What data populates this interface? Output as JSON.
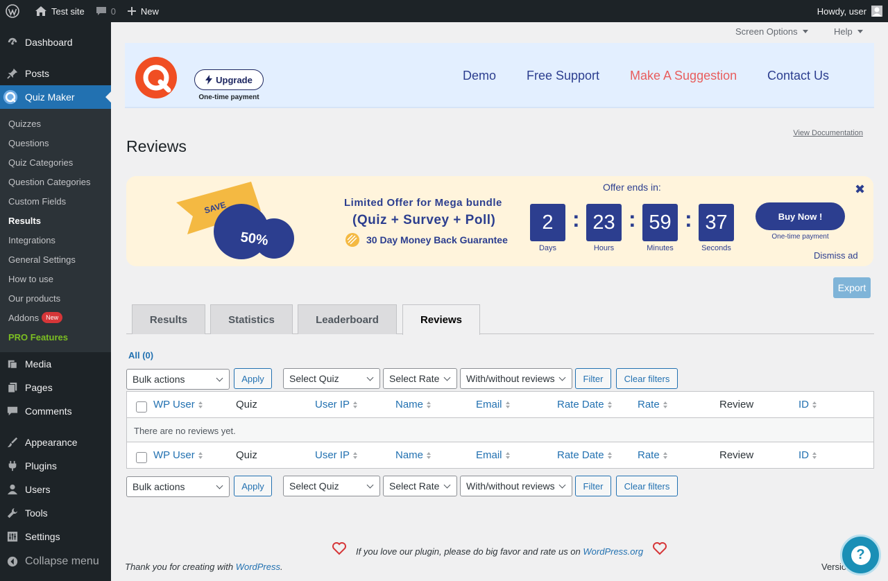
{
  "adminbar": {
    "site_name": "Test site",
    "comments_count": "0",
    "new_label": "New",
    "howdy": "Howdy, user"
  },
  "sidebar": {
    "dashboard": "Dashboard",
    "posts": "Posts",
    "quiz_maker": "Quiz Maker",
    "submenu": [
      "Quizzes",
      "Questions",
      "Quiz Categories",
      "Question Categories",
      "Custom Fields",
      "Results",
      "Integrations",
      "General Settings",
      "How to use",
      "Our products",
      "Addons",
      "PRO Features"
    ],
    "addons_badge": "New",
    "media": "Media",
    "pages": "Pages",
    "comments": "Comments",
    "appearance": "Appearance",
    "plugins": "Plugins",
    "users": "Users",
    "tools": "Tools",
    "settings": "Settings",
    "collapse": "Collapse menu"
  },
  "screen_meta": {
    "screen_options": "Screen Options",
    "help": "Help"
  },
  "plugin_header": {
    "upgrade": "Upgrade",
    "upgrade_sub": "One-time payment",
    "nav": [
      "Demo",
      "Free Support",
      "Make A Suggestion",
      "Contact Us"
    ]
  },
  "page": {
    "title": "Reviews",
    "view_doc": "View Documentation"
  },
  "banner": {
    "save": "SAVE",
    "percent": "50%",
    "line1_a": "Limited",
    "line1_b": " Offer for Mega bundle",
    "line2": "(Quiz + Survey + Poll)",
    "line3": "30 Day Money Back Guarantee",
    "offer_ends": "Offer ends in:",
    "countdown": [
      {
        "value": "2",
        "label": "Days"
      },
      {
        "value": "23",
        "label": "Hours"
      },
      {
        "value": "59",
        "label": "Minutes"
      },
      {
        "value": "37",
        "label": "Seconds"
      }
    ],
    "buy": "Buy Now !",
    "buy_sub": "One-time payment",
    "dismiss": "Dismiss ad"
  },
  "export": "Export",
  "tabs": [
    "Results",
    "Statistics",
    "Leaderboard",
    "Reviews"
  ],
  "all_link": "All (0)",
  "controls": {
    "bulk": "Bulk actions",
    "apply": "Apply",
    "select_quiz": "Select Quiz",
    "select_rate": "Select Rate",
    "with_without": "With/without reviews",
    "filter": "Filter",
    "clear": "Clear filters"
  },
  "table": {
    "columns": [
      "WP User",
      "Quiz",
      "User IP",
      "Name",
      "Email",
      "Rate Date",
      "Rate",
      "Review",
      "ID"
    ],
    "empty": "There are no reviews yet."
  },
  "footer": {
    "love_text": "If you love our plugin, please do big favor and rate us on ",
    "love_link": "WordPress.org",
    "thanks": "Thank you for creating with ",
    "thanks_link": "WordPress",
    "thanks_end": ".",
    "version": "Versio"
  },
  "colors": {
    "admin_dark": "#1d2327",
    "wp_blue": "#2271b1",
    "plugin_navy": "#2c3e8f",
    "suggest_red": "#e85d5d",
    "banner_bg": "#fff4dc",
    "logo_orange": "#f04e23"
  }
}
